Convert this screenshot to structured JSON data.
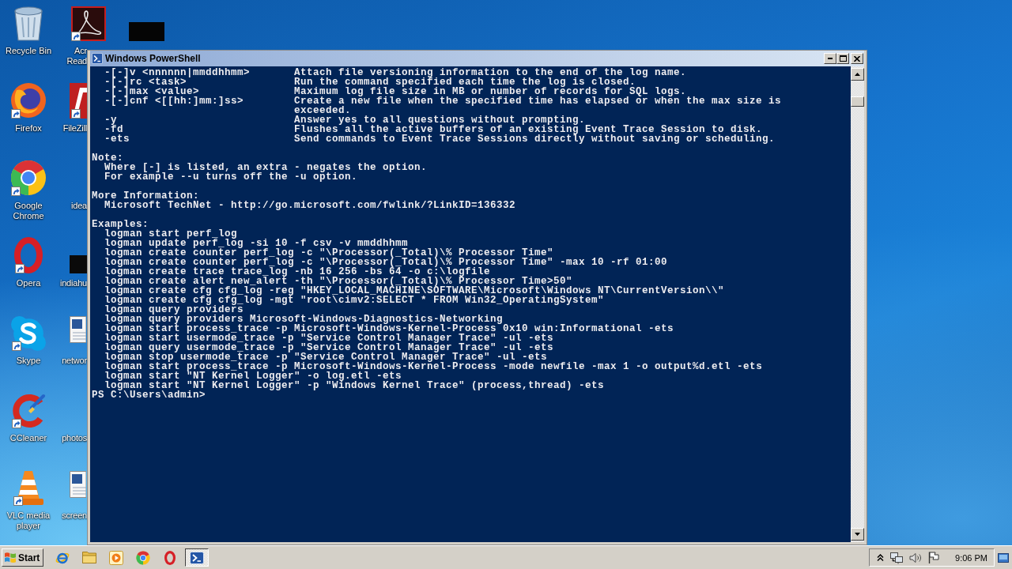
{
  "desktop": {
    "icons": [
      {
        "lines": [
          "Recycle Bin"
        ],
        "shortcut": false
      },
      {
        "lines": [
          "Firefox"
        ],
        "shortcut": true
      },
      {
        "lines": [
          "Google",
          "Chrome"
        ],
        "shortcut": true
      },
      {
        "lines": [
          "Opera"
        ],
        "shortcut": true
      },
      {
        "lines": [
          "Skype"
        ],
        "shortcut": true
      },
      {
        "lines": [
          "CCleaner"
        ],
        "shortcut": true
      },
      {
        "lines": [
          "VLC media",
          "player"
        ],
        "shortcut": true
      },
      {
        "lines": [
          "Acr",
          "Read"
        ],
        "shortcut": true
      },
      {
        "lines": [
          "FileZill"
        ],
        "shortcut": true
      },
      {
        "lines": [
          "idea"
        ],
        "shortcut": false
      },
      {
        "lines": [
          "indiahu"
        ],
        "shortcut": false
      },
      {
        "lines": [
          "networ"
        ],
        "shortcut": false
      },
      {
        "lines": [
          "photos"
        ],
        "shortcut": false
      },
      {
        "lines": [
          "screen"
        ],
        "shortcut": false
      }
    ]
  },
  "window": {
    "title": "Windows PowerShell",
    "console": {
      "options": [
        {
          "flag": "-[-]v <nnnnnn|mmddhhmm>",
          "description": "Attach file versioning information to the end of the log name."
        },
        {
          "flag": "-[-]rc <task>",
          "description": "Run the command specified each time the log is closed."
        },
        {
          "flag": "-[-]max <value>",
          "description": "Maximum log file size in MB or number of records for SQL logs."
        },
        {
          "flag": "-[-]cnf <[[hh:]mm:]ss>",
          "description": "Create a new file when the specified time has elapsed or when the max size is exceeded."
        },
        {
          "flag": "-y",
          "description": "Answer yes to all questions without prompting."
        },
        {
          "flag": "-fd",
          "description": "Flushes all the active buffers of an existing Event Trace Session to disk."
        },
        {
          "flag": "-ets",
          "description": "Send commands to Event Trace Sessions directly without saving or scheduling."
        }
      ],
      "sections": [
        {
          "heading": "Note:",
          "lines": [
            "Where [-] is listed, an extra - negates the option.",
            "For example --u turns off the -u option."
          ]
        },
        {
          "heading": "More Information:",
          "lines": [
            "Microsoft TechNet - http://go.microsoft.com/fwlink/?LinkID=136332"
          ]
        },
        {
          "heading": "Examples:",
          "lines": [
            "logman start perf_log",
            "logman update perf_log -si 10 -f csv -v mmddhhmm",
            "logman create counter perf_log -c \"\\Processor(_Total)\\% Processor Time\"",
            "logman create counter perf_log -c \"\\Processor(_Total)\\% Processor Time\" -max 10 -rf 01:00",
            "logman create trace trace_log -nb 16 256 -bs 64 -o c:\\logfile",
            "logman create alert new_alert -th \"\\Processor(_Total)\\% Processor Time>50\"",
            "logman create cfg cfg_log -reg \"HKEY_LOCAL_MACHINE\\SOFTWARE\\Microsoft\\Windows NT\\CurrentVersion\\\\\"",
            "logman create cfg cfg_log -mgt \"root\\cimv2:SELECT * FROM Win32_OperatingSystem\"",
            "logman query providers",
            "logman query providers Microsoft-Windows-Diagnostics-Networking",
            "logman start process_trace -p Microsoft-Windows-Kernel-Process 0x10 win:Informational -ets",
            "logman start usermode_trace -p \"Service Control Manager Trace\" -ul -ets",
            "logman query usermode_trace -p \"Service Control Manager Trace\" -ul -ets",
            "logman stop usermode_trace -p \"Service Control Manager Trace\" -ul -ets",
            "logman start process_trace -p Microsoft-Windows-Kernel-Process -mode newfile -max 1 -o output%d.etl -ets",
            "logman start \"NT Kernel Logger\" -o log.etl -ets",
            "logman start \"NT Kernel Logger\" -p \"Windows Kernel Trace\" (process,thread) -ets"
          ]
        }
      ],
      "prompt": "PS C:\\Users\\admin>"
    }
  },
  "taskbar": {
    "start": "Start",
    "buttons": [
      {
        "selected": false
      },
      {
        "selected": false
      },
      {
        "selected": false
      },
      {
        "selected": false
      },
      {
        "selected": false
      },
      {
        "selected": true
      }
    ],
    "clock": "9:06 PM"
  }
}
